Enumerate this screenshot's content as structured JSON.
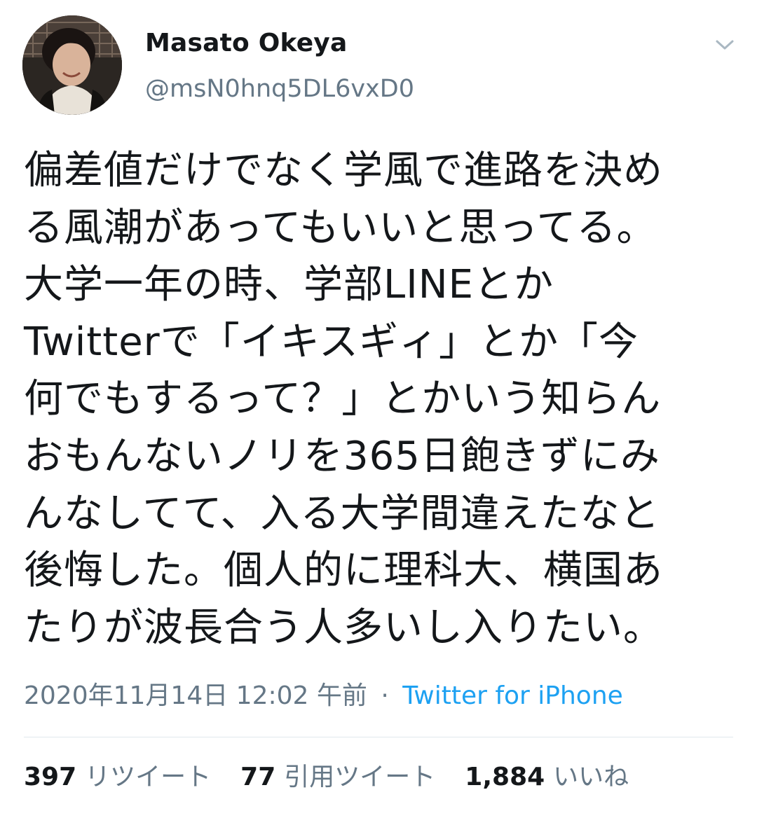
{
  "author": {
    "display_name": "Masato Okeya",
    "handle": "@msN0hnq5DL6vxD0"
  },
  "menu_icon": "chevron-down-icon",
  "tweet_text": "偏差値だけでなく学風で進路を決め\nる風潮があってもいいと思ってる。\n大学一年の時、学部LINEとか\nTwitterで「イキスギィ」とか「今\n何でもするって？」とかいう知らん\nおもんないノリを365日飽きずにみ\nんなしてて、入る大学間違えたなと\n後悔した。個人的に理科大、横国あ\nたりが波長合う人多いし入りたい。",
  "meta": {
    "timestamp": "2020年11月14日 12:02 午前",
    "separator": "·",
    "source": "Twitter for iPhone"
  },
  "stats": [
    {
      "count": "397",
      "label": "リツイート"
    },
    {
      "count": "77",
      "label": "引用ツイート"
    },
    {
      "count": "1,884",
      "label": "いいね"
    }
  ],
  "colors": {
    "text": "#14171a",
    "secondary": "#657786",
    "link": "#1da1f2",
    "divider": "#e1e8ed"
  }
}
